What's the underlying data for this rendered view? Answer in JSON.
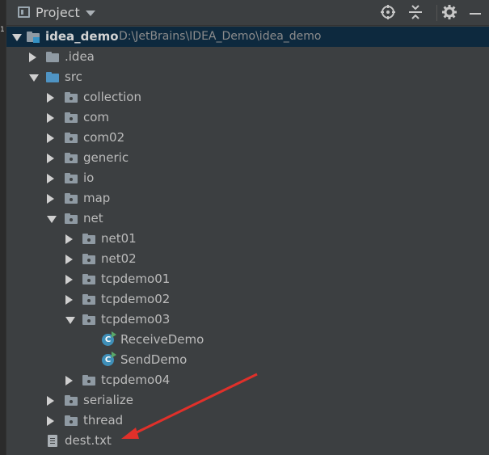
{
  "header": {
    "title": "Project",
    "tools": [
      "crosshair-icon",
      "collapse-icon",
      "gear-icon",
      "hide-icon"
    ]
  },
  "side_strip": {
    "text": "1:"
  },
  "tree": [
    {
      "label": "idea_demo",
      "path": "D:\\JetBrains\\IDEA_Demo\\idea_demo",
      "icon": "module-folder-icon",
      "state": "expanded",
      "level": 0,
      "selected": true
    },
    {
      "label": ".idea",
      "icon": "folder-icon",
      "state": "collapsed",
      "level": 1
    },
    {
      "label": "src",
      "icon": "source-folder-icon",
      "state": "expanded",
      "level": 1
    },
    {
      "label": "collection",
      "icon": "package-icon",
      "state": "collapsed",
      "level": 2
    },
    {
      "label": "com",
      "icon": "package-icon",
      "state": "collapsed",
      "level": 2
    },
    {
      "label": "com02",
      "icon": "package-icon",
      "state": "collapsed",
      "level": 2
    },
    {
      "label": "generic",
      "icon": "package-icon",
      "state": "collapsed",
      "level": 2
    },
    {
      "label": "io",
      "icon": "package-icon",
      "state": "collapsed",
      "level": 2
    },
    {
      "label": "map",
      "icon": "package-icon",
      "state": "collapsed",
      "level": 2
    },
    {
      "label": "net",
      "icon": "package-icon",
      "state": "expanded",
      "level": 2
    },
    {
      "label": "net01",
      "icon": "package-icon",
      "state": "collapsed",
      "level": 3
    },
    {
      "label": "net02",
      "icon": "package-icon",
      "state": "collapsed",
      "level": 3
    },
    {
      "label": "tcpdemo01",
      "icon": "package-icon",
      "state": "collapsed",
      "level": 3
    },
    {
      "label": "tcpdemo02",
      "icon": "package-icon",
      "state": "collapsed",
      "level": 3
    },
    {
      "label": "tcpdemo03",
      "icon": "package-icon",
      "state": "expanded",
      "level": 3
    },
    {
      "label": "ReceiveDemo",
      "icon": "java-class-icon",
      "state": "leaf",
      "level": 4
    },
    {
      "label": "SendDemo",
      "icon": "java-class-icon",
      "state": "leaf",
      "level": 4
    },
    {
      "label": "tcpdemo04",
      "icon": "package-icon",
      "state": "collapsed",
      "level": 3
    },
    {
      "label": "serialize",
      "icon": "package-icon",
      "state": "collapsed",
      "level": 2
    },
    {
      "label": "thread",
      "icon": "package-icon",
      "state": "collapsed",
      "level": 2
    },
    {
      "label": "dest.txt",
      "icon": "text-file-icon",
      "state": "leaf",
      "level": 1
    }
  ],
  "colors": {
    "background": "#3c3f41",
    "selection": "#0d293e",
    "arrow_annotation": "#e0302a"
  }
}
